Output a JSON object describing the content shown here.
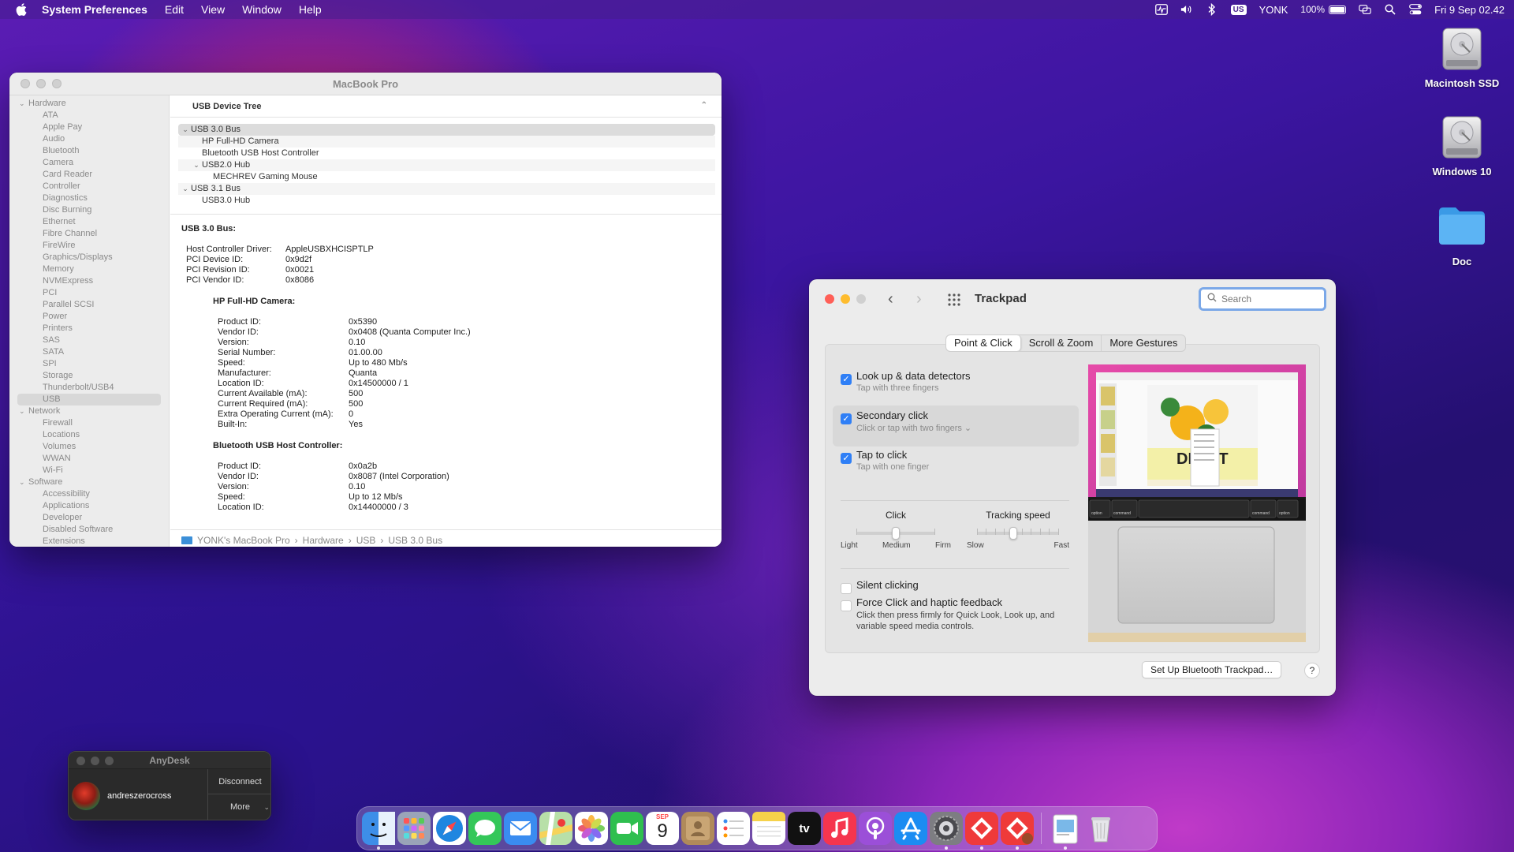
{
  "menubar": {
    "app_name": "System Preferences",
    "menus": [
      "Edit",
      "View",
      "Window",
      "Help"
    ],
    "input_source": "US",
    "user": "YONK",
    "battery": "100%",
    "clock": "Fri 9 Sep  02.42"
  },
  "desktop": {
    "icons": [
      {
        "label": "Macintosh SSD",
        "icon": "hard-disk-icon"
      },
      {
        "label": "Windows 10",
        "icon": "hard-disk-icon"
      },
      {
        "label": "Doc",
        "icon": "folder-icon"
      }
    ]
  },
  "sysinfo": {
    "title": "MacBook Pro",
    "sidebar": [
      {
        "type": "group",
        "label": "Hardware"
      },
      {
        "type": "item",
        "label": "ATA"
      },
      {
        "type": "item",
        "label": "Apple Pay"
      },
      {
        "type": "item",
        "label": "Audio"
      },
      {
        "type": "item",
        "label": "Bluetooth"
      },
      {
        "type": "item",
        "label": "Camera"
      },
      {
        "type": "item",
        "label": "Card Reader"
      },
      {
        "type": "item",
        "label": "Controller"
      },
      {
        "type": "item",
        "label": "Diagnostics"
      },
      {
        "type": "item",
        "label": "Disc Burning"
      },
      {
        "type": "item",
        "label": "Ethernet"
      },
      {
        "type": "item",
        "label": "Fibre Channel"
      },
      {
        "type": "item",
        "label": "FireWire"
      },
      {
        "type": "item",
        "label": "Graphics/Displays"
      },
      {
        "type": "item",
        "label": "Memory"
      },
      {
        "type": "item",
        "label": "NVMExpress"
      },
      {
        "type": "item",
        "label": "PCI"
      },
      {
        "type": "item",
        "label": "Parallel SCSI"
      },
      {
        "type": "item",
        "label": "Power"
      },
      {
        "type": "item",
        "label": "Printers"
      },
      {
        "type": "item",
        "label": "SAS"
      },
      {
        "type": "item",
        "label": "SATA"
      },
      {
        "type": "item",
        "label": "SPI"
      },
      {
        "type": "item",
        "label": "Storage"
      },
      {
        "type": "item",
        "label": "Thunderbolt/USB4"
      },
      {
        "type": "item",
        "label": "USB",
        "selected": true
      },
      {
        "type": "group",
        "label": "Network"
      },
      {
        "type": "item",
        "label": "Firewall"
      },
      {
        "type": "item",
        "label": "Locations"
      },
      {
        "type": "item",
        "label": "Volumes"
      },
      {
        "type": "item",
        "label": "WWAN"
      },
      {
        "type": "item",
        "label": "Wi-Fi"
      },
      {
        "type": "group",
        "label": "Software"
      },
      {
        "type": "item",
        "label": "Accessibility"
      },
      {
        "type": "item",
        "label": "Applications"
      },
      {
        "type": "item",
        "label": "Developer"
      },
      {
        "type": "item",
        "label": "Disabled Software"
      },
      {
        "type": "item",
        "label": "Extensions"
      }
    ],
    "tree_header": "USB Device Tree",
    "tree": [
      {
        "label": "USB 3.0 Bus",
        "level": 0,
        "expanded": true,
        "selected": true
      },
      {
        "label": "HP Full-HD Camera",
        "level": 1
      },
      {
        "label": "Bluetooth USB Host Controller",
        "level": 1
      },
      {
        "label": "USB2.0 Hub",
        "level": 1,
        "expanded": true
      },
      {
        "label": "MECHREV Gaming Mouse",
        "level": 2
      },
      {
        "label": "USB 3.1 Bus",
        "level": 0,
        "expanded": true
      },
      {
        "label": "USB3.0 Hub",
        "level": 1
      }
    ],
    "details": {
      "bus_title": "USB 3.0 Bus:",
      "bus_props": [
        [
          "Host Controller Driver:",
          "AppleUSBXHCISPTLP"
        ],
        [
          "PCI Device ID:",
          "0x9d2f"
        ],
        [
          "PCI Revision ID:",
          "0x0021"
        ],
        [
          "PCI Vendor ID:",
          "0x8086"
        ]
      ],
      "devices": [
        {
          "title": "HP Full-HD Camera:",
          "props": [
            [
              "Product ID:",
              "0x5390"
            ],
            [
              "Vendor ID:",
              "0x0408  (Quanta Computer Inc.)"
            ],
            [
              "Version:",
              "0.10"
            ],
            [
              "Serial Number:",
              "01.00.00"
            ],
            [
              "Speed:",
              "Up to 480 Mb/s"
            ],
            [
              "Manufacturer:",
              "Quanta"
            ],
            [
              "Location ID:",
              "0x14500000 / 1"
            ],
            [
              "Current Available (mA):",
              "500"
            ],
            [
              "Current Required (mA):",
              "500"
            ],
            [
              "Extra Operating Current (mA):",
              "0"
            ],
            [
              "Built-In:",
              "Yes"
            ]
          ]
        },
        {
          "title": "Bluetooth USB Host Controller:",
          "props": [
            [
              "Product ID:",
              "0x0a2b"
            ],
            [
              "Vendor ID:",
              "0x8087  (Intel Corporation)"
            ],
            [
              "Version:",
              "0.10"
            ],
            [
              "Speed:",
              "Up to 12 Mb/s"
            ],
            [
              "Location ID:",
              "0x14400000 / 3"
            ]
          ]
        }
      ]
    },
    "breadcrumb": [
      "YONK's MacBook Pro",
      "Hardware",
      "USB",
      "USB 3.0 Bus"
    ]
  },
  "trackpad": {
    "title": "Trackpad",
    "search_placeholder": "Search",
    "tabs": [
      "Point & Click",
      "Scroll & Zoom",
      "More Gestures"
    ],
    "active_tab": "Point & Click",
    "options": [
      {
        "label": "Look up & data detectors",
        "sub": "Tap with three fingers",
        "checked": true
      },
      {
        "label": "Secondary click",
        "sub": "Click or tap with two fingers ⌄",
        "checked": true
      },
      {
        "label": "Tap to click",
        "sub": "Tap with one finger",
        "checked": true
      }
    ],
    "click_slider": {
      "label": "Click",
      "min_label": "Light",
      "mid_label": "Medium",
      "max_label": "Firm",
      "value": 0.5
    },
    "tracking_slider": {
      "label": "Tracking speed",
      "min_label": "Slow",
      "max_label": "Fast",
      "value": 0.44
    },
    "silent_clicking": {
      "label": "Silent clicking",
      "checked": false
    },
    "force_click": {
      "label": "Force Click and haptic feedback",
      "checked": false,
      "description": "Click then press firmly for Quick Look, Look up, and variable speed media controls."
    },
    "preview_keys": [
      "option",
      "command",
      "command",
      "option"
    ],
    "preview_banner": "DIS   CT",
    "bt_button": "Set Up Bluetooth Trackpad…",
    "help": "?"
  },
  "anydesk": {
    "title": "AnyDesk",
    "user": "andreszerocross",
    "disconnect": "Disconnect",
    "more": "More"
  },
  "dock": {
    "calendar_month": "SEP",
    "calendar_day": "9",
    "apple_tv": "tv",
    "items": [
      {
        "name": "finder",
        "color": "#3d8ee8",
        "running": true
      },
      {
        "name": "launchpad",
        "color": "#9aa4b8",
        "running": false
      },
      {
        "name": "safari",
        "color": "#1f86e0",
        "running": false
      },
      {
        "name": "messages",
        "color": "#34c759",
        "running": false
      },
      {
        "name": "mail",
        "color": "#3a8cf0",
        "running": false
      },
      {
        "name": "maps",
        "color": "#5ab55e",
        "running": false
      },
      {
        "name": "photos",
        "color": "#f0f0f0",
        "running": false
      },
      {
        "name": "facetime",
        "color": "#2fbf4f",
        "running": false
      },
      {
        "name": "calendar",
        "color": "#ffffff",
        "running": false
      },
      {
        "name": "contacts",
        "color": "#b08a5a",
        "running": false
      },
      {
        "name": "reminders",
        "color": "#f7f7f7",
        "running": false
      },
      {
        "name": "notes",
        "color": "#f6d24a",
        "running": false
      },
      {
        "name": "apple-tv",
        "color": "#111111",
        "running": false
      },
      {
        "name": "music",
        "color": "#f5354e",
        "running": false
      },
      {
        "name": "podcasts",
        "color": "#9b4fd8",
        "running": false
      },
      {
        "name": "app-store",
        "color": "#1b8cf2",
        "running": false
      },
      {
        "name": "system-preferences",
        "color": "#7d7d82",
        "running": true
      },
      {
        "name": "anydesk",
        "color": "#ef3a3a",
        "running": true
      },
      {
        "name": "anydesk-alt",
        "color": "#ef3a3a",
        "running": true
      },
      {
        "name": "preview",
        "color": "#e8e8e8",
        "running": true
      }
    ]
  }
}
